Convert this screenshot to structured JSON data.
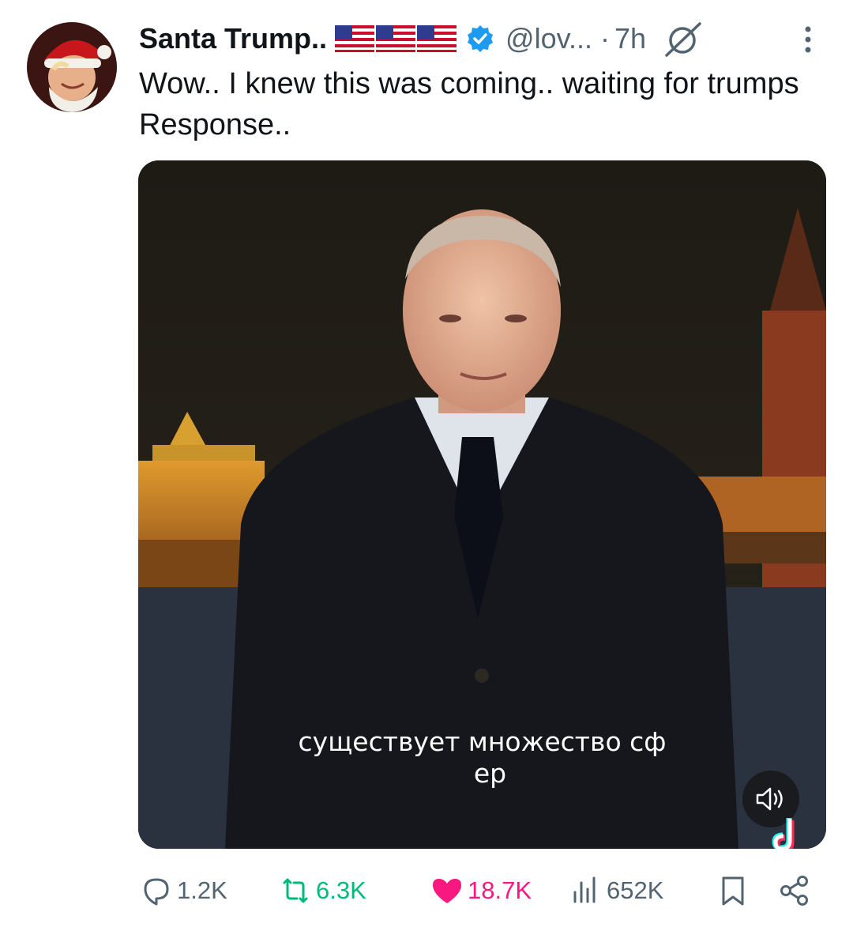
{
  "post": {
    "display_name": "Santa Trump..",
    "flags": [
      "us-flag",
      "us-flag",
      "us-flag"
    ],
    "verified": true,
    "handle": "@lov...",
    "separator": "·",
    "time": "7h",
    "text": "Wow.. I knew this was coming.. waiting for trumps Response.."
  },
  "media": {
    "subtitle_line1": "существует множество сф",
    "subtitle_line2": "ер",
    "mute_icon": "speaker-muted-icon",
    "watermark_icon": "tiktok-logo-icon"
  },
  "actions": {
    "replies": "1.2K",
    "reposts": "6.3K",
    "likes": "18.7K",
    "views": "652K"
  },
  "colors": {
    "text_primary": "#0f1419",
    "text_secondary": "#536471",
    "verified_blue": "#1d9bf0",
    "repost_green": "#00ba7c",
    "like_pink": "#f91880"
  }
}
